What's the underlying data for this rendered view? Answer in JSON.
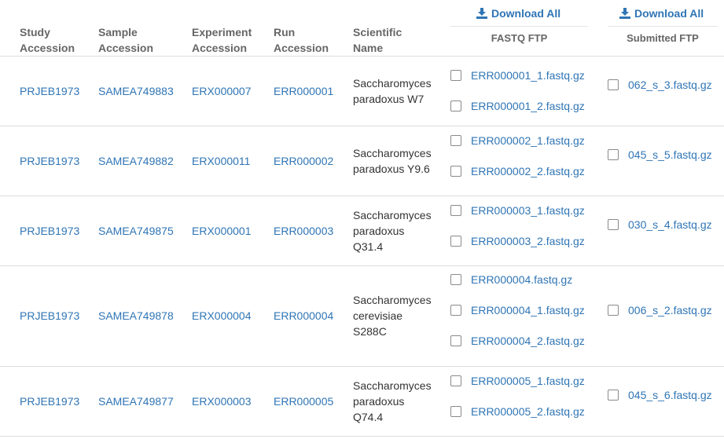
{
  "header": {
    "study_accession": [
      "Study",
      "Accession"
    ],
    "sample_accession": [
      "Sample",
      "Accession"
    ],
    "experiment_accession": [
      "Experiment",
      "Accession"
    ],
    "run_accession": [
      "Run",
      "Accession"
    ],
    "scientific_name": [
      "Scientific",
      "Name"
    ],
    "fastq": {
      "download_label": "Download All",
      "title": "FASTQ FTP"
    },
    "submitted": {
      "download_label": "Download All",
      "title": "Submitted FTP"
    }
  },
  "icons": {
    "download": "download-icon",
    "checkbox": "checkbox-unchecked"
  },
  "colors": {
    "link": "#2f75b5",
    "header_text": "#666666",
    "row_border": "#dddddd"
  },
  "rows": [
    {
      "study": "PRJEB1973",
      "sample": "SAMEA749883",
      "experiment": "ERX000007",
      "run": "ERR000001",
      "scientific_name": [
        "Saccharomyces",
        "paradoxus W7"
      ],
      "fastq_files": [
        "ERR000001_1.fastq.gz",
        "ERR000001_2.fastq.gz"
      ],
      "submitted_files": [
        "062_s_3.fastq.gz"
      ]
    },
    {
      "study": "PRJEB1973",
      "sample": "SAMEA749882",
      "experiment": "ERX000011",
      "run": "ERR000002",
      "scientific_name": [
        "Saccharomyces",
        "paradoxus Y9.6"
      ],
      "fastq_files": [
        "ERR000002_1.fastq.gz",
        "ERR000002_2.fastq.gz"
      ],
      "submitted_files": [
        "045_s_5.fastq.gz"
      ]
    },
    {
      "study": "PRJEB1973",
      "sample": "SAMEA749875",
      "experiment": "ERX000001",
      "run": "ERR000003",
      "scientific_name": [
        "Saccharomyces",
        "paradoxus",
        "Q31.4"
      ],
      "fastq_files": [
        "ERR000003_1.fastq.gz",
        "ERR000003_2.fastq.gz"
      ],
      "submitted_files": [
        "030_s_4.fastq.gz"
      ]
    },
    {
      "study": "PRJEB1973",
      "sample": "SAMEA749878",
      "experiment": "ERX000004",
      "run": "ERR000004",
      "scientific_name": [
        "Saccharomyces",
        "cerevisiae",
        "S288C"
      ],
      "fastq_files": [
        "ERR000004.fastq.gz",
        "ERR000004_1.fastq.gz",
        "ERR000004_2.fastq.gz"
      ],
      "submitted_files": [
        "006_s_2.fastq.gz"
      ]
    },
    {
      "study": "PRJEB1973",
      "sample": "SAMEA749877",
      "experiment": "ERX000003",
      "run": "ERR000005",
      "scientific_name": [
        "Saccharomyces",
        "paradoxus",
        "Q74.4"
      ],
      "fastq_files": [
        "ERR000005_1.fastq.gz",
        "ERR000005_2.fastq.gz"
      ],
      "submitted_files": [
        "045_s_6.fastq.gz"
      ]
    }
  ]
}
